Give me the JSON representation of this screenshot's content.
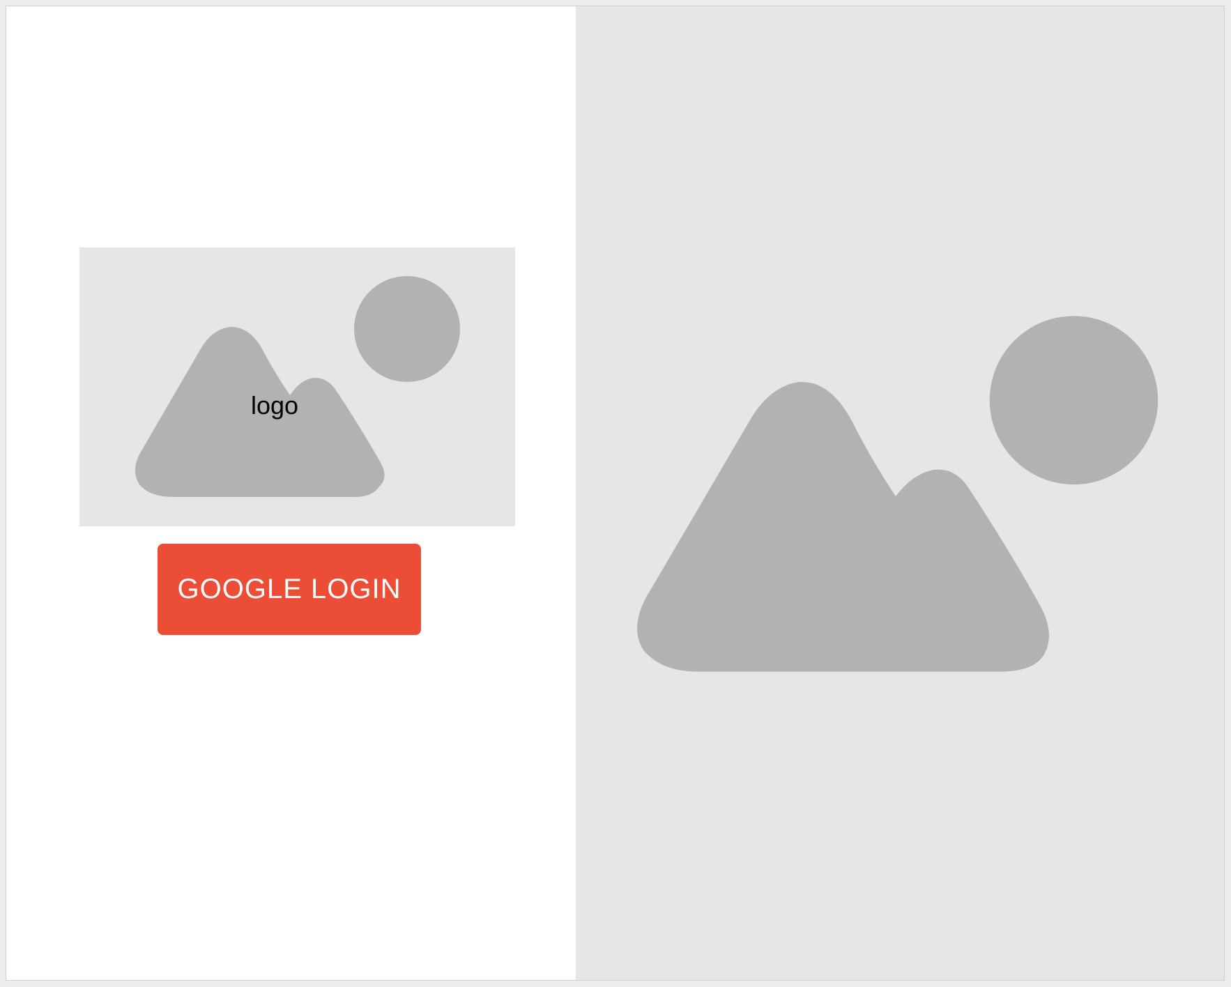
{
  "login": {
    "logo_label": "logo",
    "google_button_label": "GOOGLE LOGIN"
  },
  "placeholders": {
    "logo_icon": "image-placeholder-icon",
    "hero_icon": "image-placeholder-icon"
  },
  "colors": {
    "button_bg": "#ec4d37",
    "button_text": "#ffffff",
    "placeholder_bg": "#e6e6e6",
    "placeholder_shape": "#b2b2b2"
  }
}
